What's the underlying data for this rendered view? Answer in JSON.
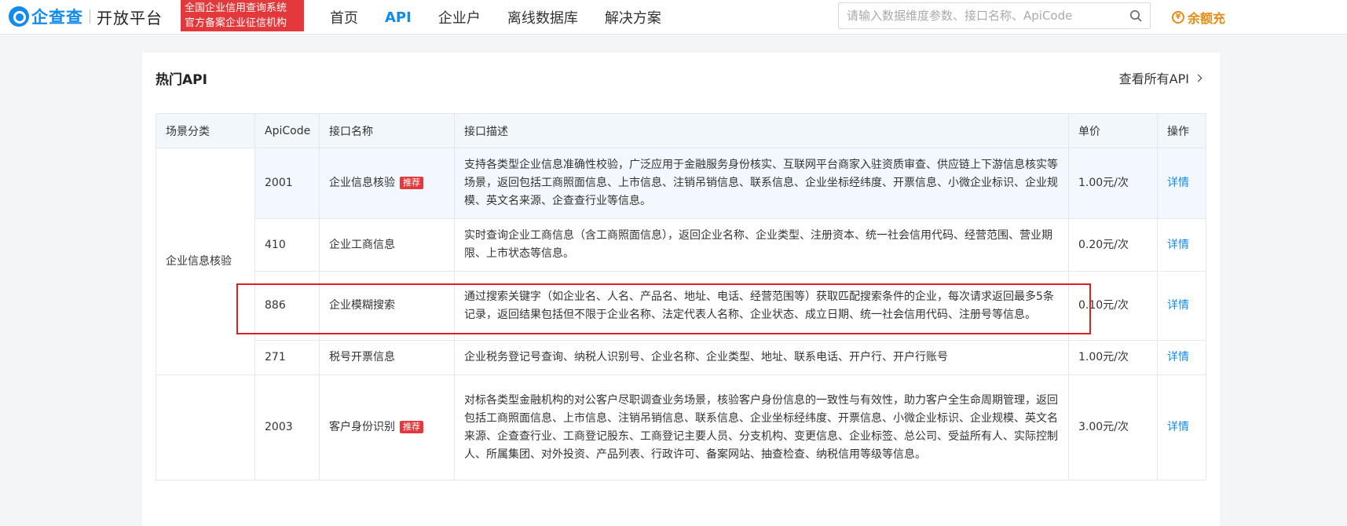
{
  "header": {
    "logo_text": "企查查",
    "logo_sub": "开放平台",
    "badge_line1": "全国企业信用查询系统",
    "badge_line2": "官方备案企业征信机构",
    "nav": [
      {
        "label": "首页",
        "active": false
      },
      {
        "label": "API",
        "active": true
      },
      {
        "label": "企业户",
        "active": false
      },
      {
        "label": "离线数据库",
        "active": false
      },
      {
        "label": "解决方案",
        "active": false
      }
    ],
    "search_placeholder": "请输入数据维度参数、接口名称、ApiCode",
    "balance_label": "余额充"
  },
  "card": {
    "title": "热门API",
    "view_all": "查看所有API"
  },
  "table": {
    "columns": [
      "场景分类",
      "ApiCode",
      "接口名称",
      "接口描述",
      "单价",
      "操作"
    ],
    "groups": [
      {
        "scene": "企业信息核验",
        "rows": [
          {
            "code": "2001",
            "name": "企业信息核验",
            "tag": "推荐",
            "desc": "支持各类型企业信息准确性校验，广泛应用于金融服务身份核实、互联网平台商家入驻资质审查、供应链上下游信息核实等场景，返回包括工商照面信息、上市信息、注销吊销信息、联系信息、企业坐标经纬度、开票信息、小微企业标识、企业规模、英文名来源、企查查行业等信息。",
            "price": "1.00元/次",
            "action": "详情"
          },
          {
            "code": "410",
            "name": "企业工商信息",
            "tag": "",
            "desc": "实时查询企业工商信息（含工商照面信息），返回企业名称、企业类型、注册资本、统一社会信用代码、经营范围、营业期限、上市状态等信息。",
            "price": "0.20元/次",
            "action": "详情"
          },
          {
            "code": "886",
            "name": "企业模糊搜索",
            "tag": "",
            "desc": "通过搜索关键字（如企业名、人名、产品名、地址、电话、经营范围等）获取匹配搜索条件的企业，每次请求返回最多5条记录，返回结果包括但不限于企业名称、法定代表人名称、企业状态、成立日期、统一社会信用代码、注册号等信息。",
            "price": "0.10元/次",
            "action": "详情"
          },
          {
            "code": "271",
            "name": "税号开票信息",
            "tag": "",
            "desc": "企业税务登记号查询、纳税人识别号、企业名称、企业类型、地址、联系电话、开户行、开户行账号",
            "price": "1.00元/次",
            "action": "详情"
          }
        ]
      },
      {
        "scene": "",
        "rows": [
          {
            "code": "2003",
            "name": "客户身份识别",
            "tag": "推荐",
            "desc": "对标各类型金融机构的对公客户尽职调查业务场景，核验客户身份信息的一致性与有效性，助力客户全生命周期管理，返回包括工商照面信息、上市信息、注销吊销信息、联系信息、企业坐标经纬度、开票信息、小微企业标识、企业规模、英文名来源、企查查行业、工商登记股东、工商登记主要人员、分支机构、变更信息、企业标签、总公司、受益所有人、实际控制人、所属集团、对外投资、产品列表、行政许可、备案网站、抽查检查、纳税信用等级等信息。",
            "price": "3.00元/次",
            "action": "详情"
          }
        ]
      }
    ]
  },
  "colors": {
    "accent": "#128bed",
    "tag_red": "#e4393c",
    "balance": "#e38d13",
    "highlight_box": "#e02020"
  }
}
